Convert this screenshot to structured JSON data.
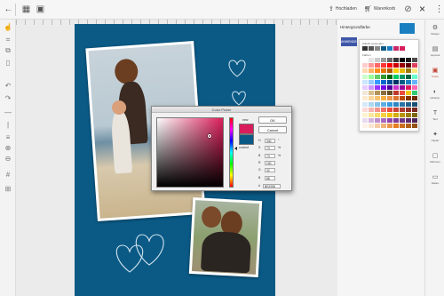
{
  "toolbar": {
    "upload_label": "Hochladen",
    "projects_label": "Warenkorb"
  },
  "sidebar_right": {
    "items": [
      {
        "label": "Design",
        "icon": "gear-icon"
      },
      {
        "label": "Layouts",
        "icon": "layout-icon"
      },
      {
        "label": "Fotos",
        "icon": "photo-icon"
      },
      {
        "label": "Hintergr.",
        "icon": "background-icon"
      },
      {
        "label": "Text",
        "icon": "text-icon"
      },
      {
        "label": "Clipart",
        "icon": "clipart-icon"
      },
      {
        "label": "Rahmen",
        "icon": "frame-icon"
      },
      {
        "label": "Seiten",
        "icon": "pages-icon"
      }
    ],
    "active_index": 2
  },
  "background_panel": {
    "title": "Hintergrundfarbe",
    "apply_label": "ANWENDEN",
    "accent": "#1a7fc1",
    "palette_recent_label": "Zuletzt verwendet",
    "palette_colors_label": "Farben"
  },
  "color_picker": {
    "title": "Color Picker",
    "new_label": "new",
    "current_label": "current",
    "ok_label": "OK",
    "cancel_label": "Cancel",
    "new_color": "#d91d5c",
    "current_color": "#0b5a86",
    "fields": [
      {
        "label": "H",
        "value": "340",
        "unit": "°"
      },
      {
        "label": "S",
        "value": "73",
        "unit": "%"
      },
      {
        "label": "B",
        "value": "73",
        "unit": "%"
      },
      {
        "label": "R",
        "value": "190",
        "unit": ""
      },
      {
        "label": "G",
        "value": "32",
        "unit": ""
      },
      {
        "label": "B",
        "value": "88",
        "unit": ""
      }
    ],
    "hex_label": "#",
    "hex_value": "BE2058"
  },
  "page_color": "#0b5a86"
}
